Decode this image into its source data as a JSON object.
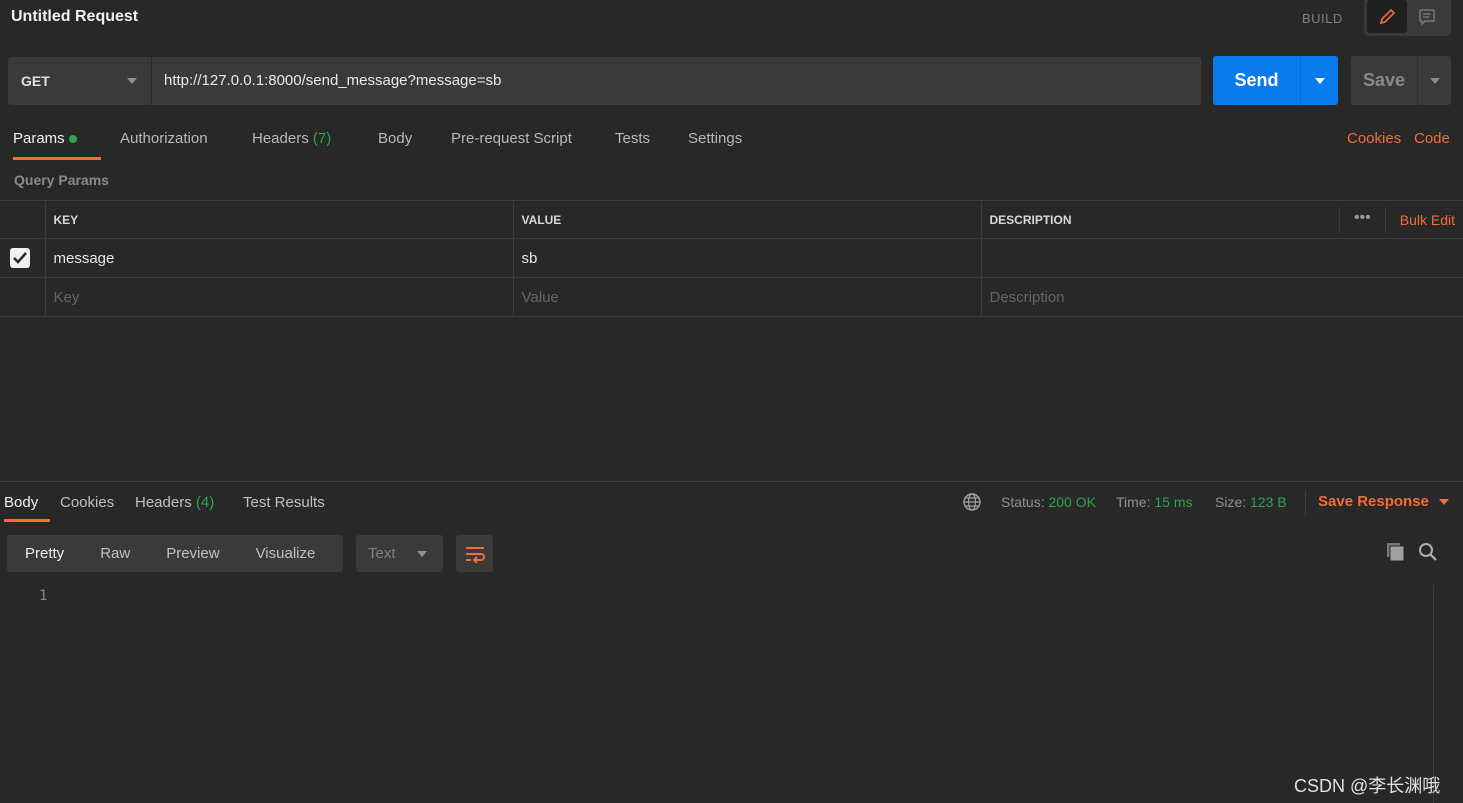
{
  "header": {
    "title": "Untitled Request",
    "mode_label": "BUILD"
  },
  "request": {
    "method": "GET",
    "url": "http://127.0.0.1:8000/send_message?message=sb",
    "send_label": "Send",
    "save_label": "Save"
  },
  "tabs": [
    {
      "label": "Params"
    },
    {
      "label": "Authorization"
    },
    {
      "label": "Headers",
      "count": "(7)"
    },
    {
      "label": "Body"
    },
    {
      "label": "Pre-request Script"
    },
    {
      "label": "Tests"
    },
    {
      "label": "Settings"
    }
  ],
  "links": {
    "cookies": "Cookies",
    "code": "Code"
  },
  "params": {
    "title": "Query Params",
    "columns": [
      "KEY",
      "VALUE",
      "DESCRIPTION"
    ],
    "bulk_edit": "Bulk Edit",
    "rows": [
      {
        "checked": true,
        "key": "message",
        "value": "sb",
        "description": ""
      }
    ],
    "placeholders": {
      "key": "Key",
      "value": "Value",
      "description": "Description"
    }
  },
  "response": {
    "tabs": [
      {
        "label": "Body"
      },
      {
        "label": "Cookies"
      },
      {
        "label": "Headers",
        "count": "(4)"
      },
      {
        "label": "Test Results"
      }
    ],
    "status_label": "Status:",
    "status": "200 OK",
    "time_label": "Time:",
    "time": "15 ms",
    "size_label": "Size:",
    "size": "123 B",
    "save_response": "Save Response",
    "views": [
      "Pretty",
      "Raw",
      "Preview",
      "Visualize"
    ],
    "format": "Text",
    "line_numbers": [
      "1"
    ]
  },
  "watermark": "CSDN @李长渊哦",
  "colors": {
    "accent": "#f26b3a",
    "send": "#097bed",
    "success": "#2fa34c",
    "background": "#282828"
  }
}
